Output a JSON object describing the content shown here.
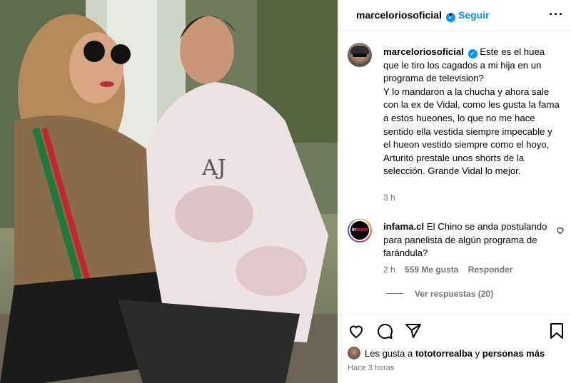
{
  "header": {
    "username": "marceloriosoficial",
    "verified_icon": "check-badge-icon",
    "separator": "•",
    "follow_label": "Seguir",
    "more_icon": "more-options-icon"
  },
  "caption": {
    "username": "marceloriosoficial",
    "text": "Este es el huea que le tiro los cagados a mi hija en un programa de television?\nY lo mandaron a la chucha y ahora sale con la ex de Vidal, como les gusta la fama a estos hueones, lo que no me hace sentido ella vestida siempre impecable y el hueon vestido siempre como el hoyo, Arturito prestale unos shorts de la selección. Grande Vidal lo mejor.",
    "time": "3 h"
  },
  "comment": {
    "username": "infama.cl",
    "avatar_text_a": "in",
    "avatar_text_b": "fama",
    "text": "El Chino se anda postulando para panelista de algún programa de farándula?",
    "time": "2 h",
    "likes": "559 Me gusta",
    "reply_label": "Responder",
    "view_replies": "Ver respuestas (20)"
  },
  "actions": {
    "like_icon": "heart-icon",
    "comment_icon": "comment-icon",
    "share_icon": "send-icon",
    "save_icon": "bookmark-icon"
  },
  "likes": {
    "prefix": "Les gusta a",
    "user": "tototorrealba",
    "connector": "y",
    "others": "personas más"
  },
  "post_time": "Hace 3 horas",
  "colors": {
    "accent": "#0095f6",
    "muted": "#737373",
    "divider": "#efefef"
  }
}
